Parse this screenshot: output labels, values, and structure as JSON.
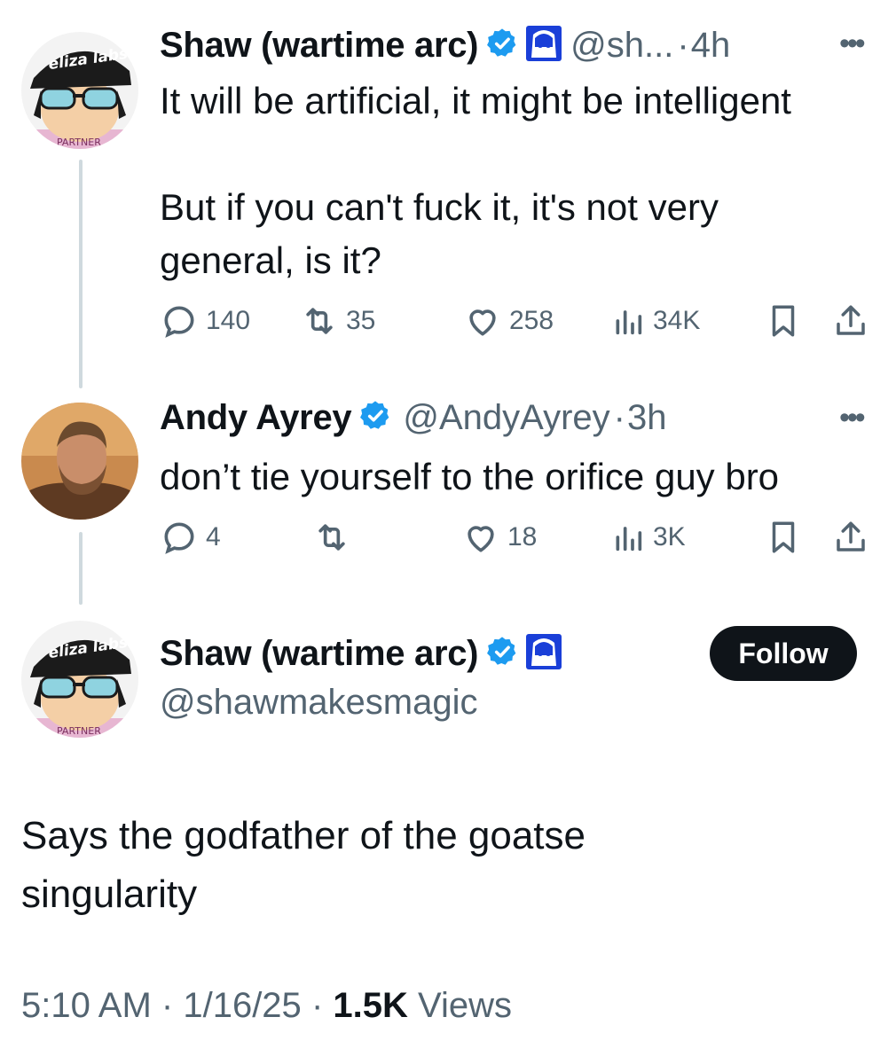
{
  "colors": {
    "verified": "#1d9bf0",
    "secondary_text": "#536471",
    "thread_line": "#cfd9de",
    "follow_bg": "#0f1419"
  },
  "tweet1": {
    "name": "Shaw (wartime arc)",
    "handle": "@sh...",
    "sep": "·",
    "time": "4h",
    "avatar_text": "eliza labs",
    "avatar_shirt_text": "PARTNER",
    "body_line1": "It will be artificial, it might be intelligent",
    "body_line2": "But if you can't fuck it, it's not very general, is it?",
    "stats": {
      "replies": "140",
      "reposts": "35",
      "likes": "258",
      "views": "34K"
    }
  },
  "tweet2": {
    "name": "Andy Ayrey",
    "handle": "@AndyAyrey",
    "sep": "·",
    "time": "3h",
    "body": "don’t tie yourself to the orifice guy bro",
    "stats": {
      "replies": "4",
      "reposts": "",
      "likes": "18",
      "views": "3K"
    }
  },
  "main": {
    "name": "Shaw (wartime arc)",
    "handle": "@shawmakesmagic",
    "follow_label": "Follow",
    "body": "Says the godfather of the goatse\nsingularity",
    "time": "5:10 AM",
    "date": "1/16/25",
    "sep": "·",
    "views_count": "1.5K",
    "views_label": "Views"
  },
  "icons": [
    "verified-badge-icon",
    "anime-avatar-badge-icon",
    "reply-icon",
    "repost-icon",
    "like-icon",
    "views-icon",
    "bookmark-icon",
    "share-icon",
    "more-icon"
  ]
}
